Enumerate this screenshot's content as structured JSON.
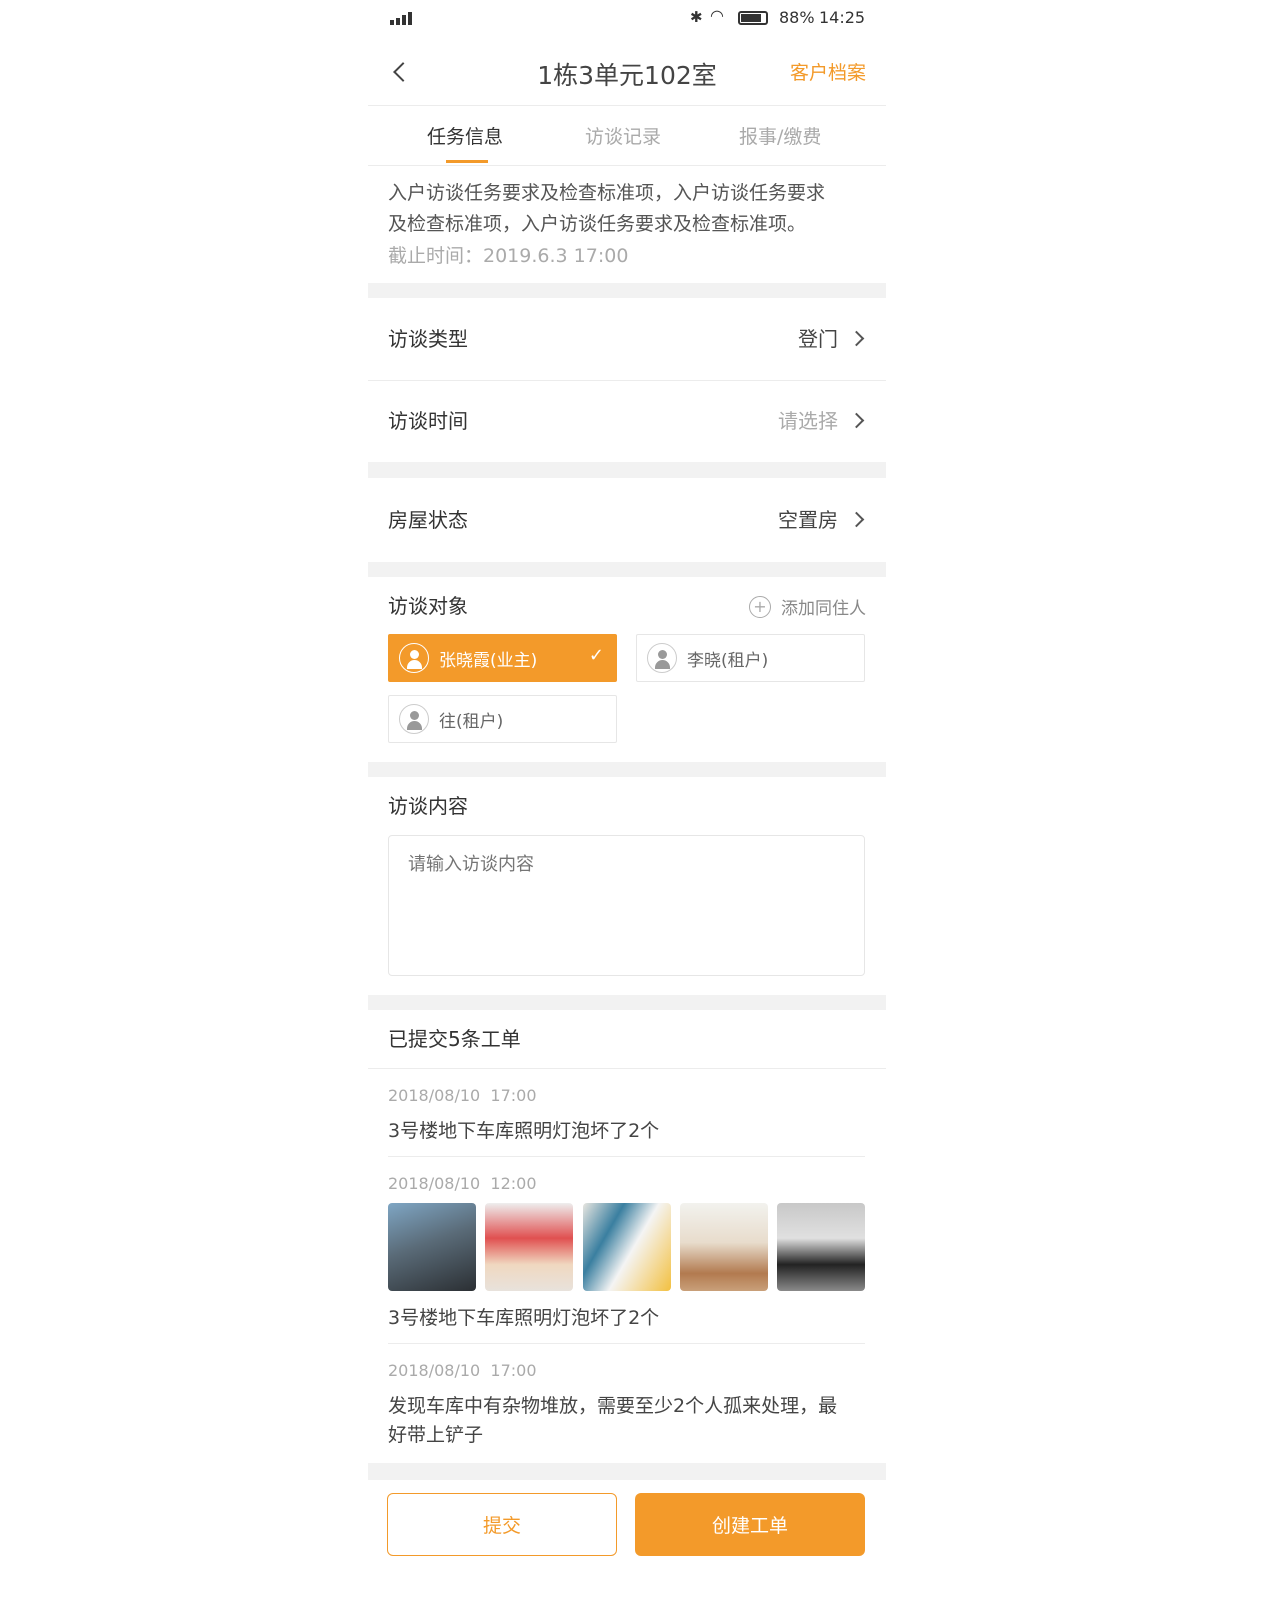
{
  "status": {
    "battery": "88%",
    "time": "14:25"
  },
  "nav": {
    "title": "1栋3单元102室",
    "right_link": "客户档案"
  },
  "tabs": [
    {
      "label": "任务信息",
      "active": true
    },
    {
      "label": "访谈记录"
    },
    {
      "label": "报事/缴费"
    }
  ],
  "task": {
    "line1": "入户访谈任务要求及检查标准项，入户访谈任务要求",
    "line2": "及检查标准项，入户访谈任务要求及检查标准项。",
    "deadline": "截止时间：2019.6.3 17:00"
  },
  "rows": [
    {
      "label": "访谈类型",
      "value": "登门"
    },
    {
      "label": "访谈时间",
      "value": "请选择"
    },
    {
      "label": "房屋状态",
      "value": "空置房"
    }
  ],
  "targets": {
    "title": "访谈对象",
    "add_label": "添加同住人",
    "people": [
      {
        "name": "张晓霞(业主)",
        "selected": true
      },
      {
        "name": "李晓(租户)"
      },
      {
        "name": "往(租户)"
      }
    ]
  },
  "content": {
    "title": "访谈内容",
    "placeholder": "请输入访谈内容"
  },
  "orders": {
    "title": "已提交5条工单",
    "items": [
      {
        "date": "2018/08/10  17:00",
        "text": "3号楼地下车库照明灯泡坏了2个"
      },
      {
        "date": "2018/08/10  12:00",
        "text": "3号楼地下车库照明灯泡坏了2个"
      },
      {
        "date": "2018/08/10  17:00",
        "text": "发现车库中有杂物堆放，需要至少2个人孤来处理，最",
        "text2": "好带上铲子"
      }
    ]
  },
  "buttons": {
    "submit": "提交",
    "create": "创建工单"
  },
  "colors": {
    "accent": "#f39a2a"
  }
}
